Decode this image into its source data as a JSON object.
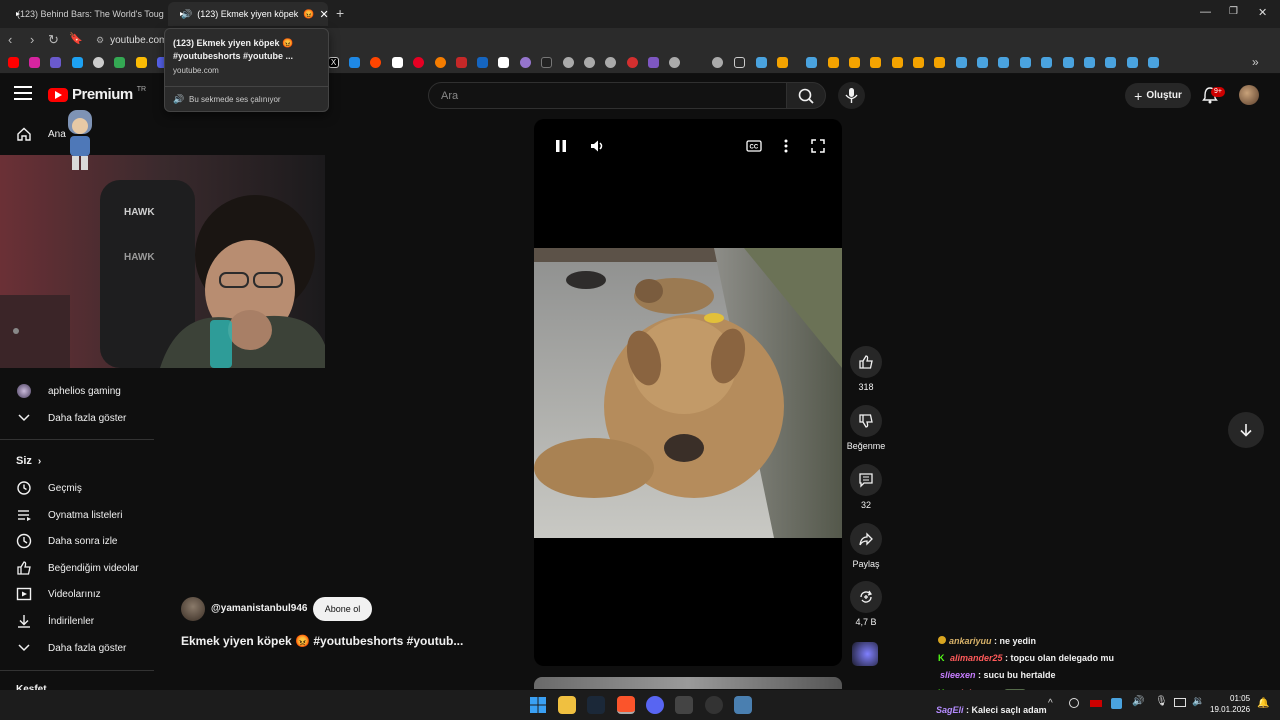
{
  "browser": {
    "tabs": [
      {
        "label": "(123) Behind Bars: The World's Tougl",
        "active": false
      },
      {
        "label": "(123) Ekmek yiyen köpek",
        "active": true
      }
    ],
    "url": "youtube.com",
    "tooltip": {
      "title": "(123) Ekmek yiyen köpek 😡 #youtubeshorts #youtube ...",
      "domain": "youtube.com",
      "audio_note": "Bu sekmede ses çalınıyor"
    }
  },
  "header": {
    "logo_word": "Premium",
    "logo_region": "TR",
    "search_placeholder": "Ara",
    "create_label": "Oluştur",
    "notifications_badge": "9+"
  },
  "sidebar": {
    "home_label": "Ana",
    "subs": [
      {
        "label": "aphelios gaming"
      }
    ],
    "show_more_1": "Daha fazla göster",
    "you_header": "Siz",
    "you_items": [
      {
        "label": "Geçmiş",
        "icon": "history-icon"
      },
      {
        "label": "Oynatma listeleri",
        "icon": "playlists-icon"
      },
      {
        "label": "Daha sonra izle",
        "icon": "watch-later-icon"
      },
      {
        "label": "Beğendiğim videolar",
        "icon": "liked-videos-icon"
      },
      {
        "label": "Videolarınız",
        "icon": "your-videos-icon"
      },
      {
        "label": "İndirilenler",
        "icon": "downloads-icon"
      }
    ],
    "show_more_2": "Daha fazla göster",
    "cut_section": "Keşfet"
  },
  "webcam": {
    "chair_brand_1": "HAWK",
    "chair_brand_2": "HAWK"
  },
  "short": {
    "channel": "@yamanistanbul946",
    "subscribe_label": "Abone ol",
    "title": "Ekmek yiyen köpek 😡 #youtubeshorts #youtub...",
    "likes": "318",
    "dislike_label": "Beğenme",
    "comments": "32",
    "share_label": "Paylaş",
    "remix_count": "4,7 B"
  },
  "chat": [
    {
      "user": "ankariyuu",
      "text": ": ne yedin",
      "color": "#d9b36a",
      "badge": "coin"
    },
    {
      "user": "alimander25",
      "text": ": topcu olan delegado mu",
      "color": "#ff5a5a",
      "badge": "K"
    },
    {
      "user": "slieexen",
      "text": ": sucu bu hertalde",
      "color": "#c77dff",
      "badge": ""
    },
    {
      "user": "solpioneer",
      "text": ":",
      "color": "#ff6a6a",
      "badge": "K"
    },
    {
      "user": "SagEli",
      "text": ": Kaleci saçlı adam",
      "color": "#b58cff",
      "badge": ""
    }
  ],
  "taskbar": {
    "time": "01:05",
    "date": "19.01.2026"
  }
}
